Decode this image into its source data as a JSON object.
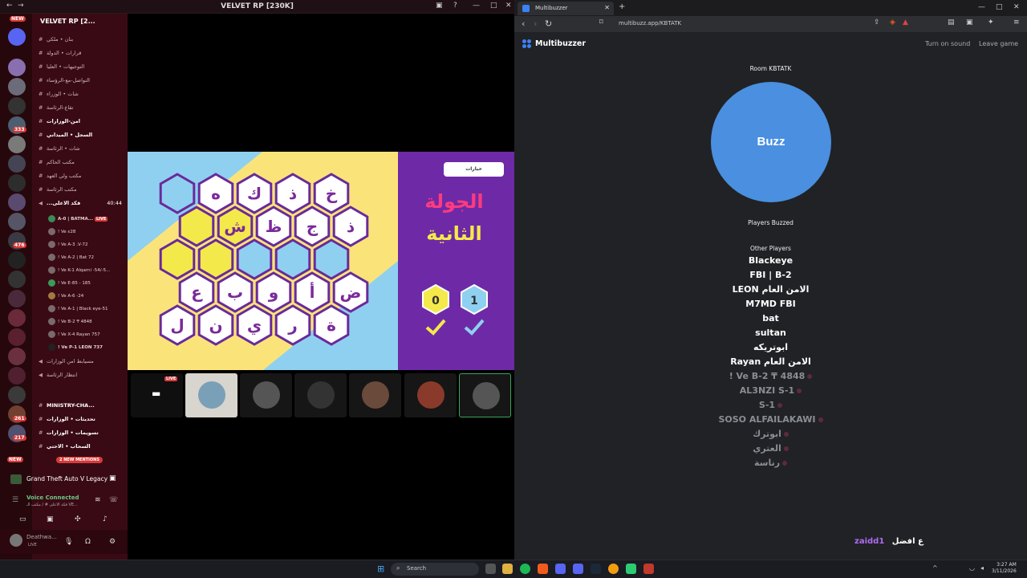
{
  "discord": {
    "title": "VELVET RP [230K]",
    "guild": "VELVET RP [2...",
    "channels": [
      "بنان • ملكي",
      "قرارات • الدولة",
      "التوجيهات • العليا",
      "التواصل-مع-الرؤساء",
      "شات • الوزراء",
      "تقاع-الرئاسة",
      "امن-الوزارات",
      "السجل • الميداني",
      "شات • الرئاسة",
      "مكتب الحاكم",
      "مكتب ولي العهد",
      "مكتب الرئاسة",
      "...فكد الاعلى"
    ],
    "voice_timer": "40:44",
    "voice_users": [
      "A-0 | BATMA...",
      "! Ve ε28",
      "! Ve A-3 .V-72",
      "! Ve A-2 | Bat 72",
      "! Ve K-1 Alqarni -54/-5...",
      "! Ve E-85 - 185",
      "! Ve A-6 -24",
      "! Ve A-1 | Black eye-51",
      "! Ve B-2 ₸ 4848",
      "! Ve X-4 Rayan 757",
      "! Ve P-1 LEON 737"
    ],
    "live_label": "LIVE",
    "lower_channels": [
      "مسيابط امن الوزارات",
      "انتظار الرئاسة",
      "MINISTRY-CHA...",
      "تحديثات • الوزارات",
      "تسويمات • الوزارات",
      "السحاب • الاحتي"
    ],
    "new_mentions": "2 NEW MENTIONS",
    "new_badge": "NEW",
    "game": "Grand Theft Auto V Legacy",
    "voice_status": "Voice Connected",
    "voice_channel": "فكد الاعلى # / مكتب الـ VE...",
    "username": "Deathwa...",
    "user_status": "LIVE",
    "badges": [
      "333",
      "476",
      "261",
      "217"
    ]
  },
  "game": {
    "button_label": "خيارات",
    "round_line1": "الجولة",
    "round_line2": "الثانية",
    "score_yellow": "0",
    "score_blue": "1",
    "hex_rows": [
      [
        "خ",
        "ذ",
        "ك",
        "ه",
        ""
      ],
      [
        "ذ",
        "ج",
        "ظ",
        "ش",
        ""
      ],
      [
        "",
        "",
        "",
        "",
        ""
      ],
      [
        "ض",
        "أ",
        "و",
        "ب",
        "ع"
      ],
      [
        "ة",
        "ر",
        "ي",
        "ن",
        "ل"
      ]
    ]
  },
  "browser": {
    "tab_title": "Multibuzzer",
    "url": "multibuzz.app/KBTATK",
    "app_name": "Multibuzzer",
    "turn_on_sound": "Turn on sound",
    "leave_game": "Leave game",
    "room": "Room KBTATK",
    "buzz": "Buzz",
    "players_buzzed": "Players Buzzed",
    "other_players": "Other Players",
    "active_players": [
      "Blackeye",
      "FBI | B-2",
      "LEON الامن العام",
      "M7MD FBI",
      "bat",
      "sultan",
      "ابوتريكه",
      "Rayan الامن العام"
    ],
    "inactive_players": [
      "! Ve B-2 ₸ 4848",
      "AL3NZI S-1",
      "S-1",
      "SOSO ALFAILAKAWI",
      "ابوترك",
      "العتري",
      "رناسة"
    ],
    "footer_user": "zaidd1",
    "footer_msg": "ع افضل"
  },
  "taskbar": {
    "search": "Search",
    "time": "3:27 AM",
    "date": "3/11/2026"
  },
  "colors": {
    "buzz": "#4a8fe0",
    "discord_bg": "#3a0a14",
    "round_pink": "#ff3a7e",
    "round_yellow": "#f4e94a",
    "purple": "#6e2aa6"
  }
}
